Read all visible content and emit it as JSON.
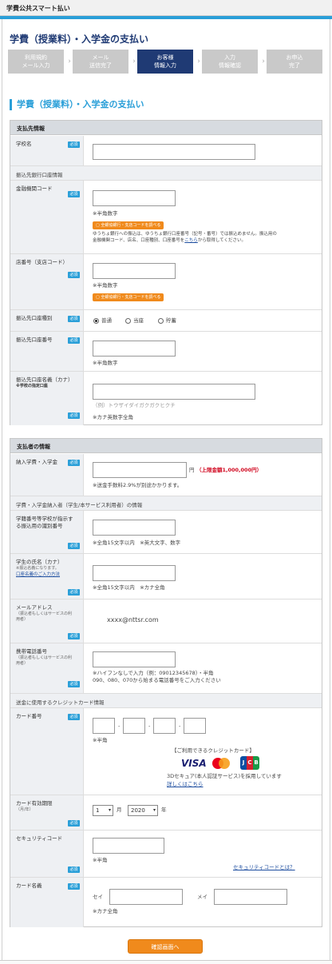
{
  "window_title": "学費公共スマート払い",
  "page_title": "学費（授業料）・入学金の支払い",
  "steps": [
    "利用規約\nメール入力",
    "メール\n送信完了",
    "お客様\n情報入力",
    "入力\n情報確認",
    "お申込\n完了"
  ],
  "section_title": "学費（授業料）・入学金の支払い",
  "required_label": "必須",
  "payee": {
    "header": "支払先情報",
    "school_label": "学校名",
    "bank_subhead": "振込先銀行口座情報",
    "bank_code_label": "金融機関コード",
    "half_digits": "※半角数字",
    "bank_code_button": "全銀協銀行・支店コードを調べる",
    "yucho_note_1": "ゆうちょ銀行への振込は、ゆうちょ銀行口座番号（記号・番号）では振込めません。振込用の",
    "yucho_note_2a": "金融機関コード、店名、口座種別、口座番号を",
    "yucho_note_link": "こちら",
    "yucho_note_2b": "から取得してください。",
    "branch_label": "店番号（支店コード）",
    "branch_button": "全銀協銀行・支店コードを調べる",
    "account_type_label": "振込先口座種別",
    "account_types": [
      "普通",
      "当座",
      "貯蓄"
    ],
    "account_number_label": "振込先口座番号",
    "account_name_label": "振込先口座名義（カナ）",
    "account_name_sub": "※学校の指定口座",
    "account_name_placeholder": "（例）トウザイダイガクガクヒクチ",
    "kana_note": "※カナ英数字全角"
  },
  "payer": {
    "header": "支払者の情報",
    "amount_label": "納入学費・入学金",
    "yen": "円",
    "limit": "（上限金額1,000,000円）",
    "fee_note": "※送金手数料2.9%が別途かかります。",
    "student_subhead": "学費・入学金納入者（学生/本サービス利用者）の情報",
    "student_id_label": "学籍番号等学校が指示する振込用の識別番号",
    "student_id_note": "※全角15文字以内　※英大文字、数字",
    "student_name_label": "学生の氏名（カナ）",
    "student_name_sub": "※振込名義になります。",
    "student_name_link": "口座名義のご入力方法",
    "student_name_note": "※全角15文字以内　※カナ全角",
    "email_label": "メールアドレス",
    "email_sub": "（振込者もしくはサービスの利用者）",
    "email_value": "xxxx@nttsr.com",
    "phone_label": "携帯電話番号",
    "phone_sub": "（振込者もしくはサービスの利用者）",
    "phone_note_1": "※ハイフンなしで入力（例：09012345678）・半角",
    "phone_note_2": "090、080、070から始まる電話番号をご入力ください",
    "card_subhead": "送金に使用するクレジットカード情報",
    "card_number_label": "カード番号",
    "card_hyphen": "-",
    "half_note": "※半角",
    "available_cards": "【ご利用できるクレジットカード】",
    "visa": "VISA",
    "jcb": [
      "J",
      "C",
      "B"
    ],
    "secure_note": "3Dセキュア(本人認証サービス)を採用しています",
    "details_link": "詳しくはこちら",
    "expiry_label": "カード有効期限",
    "expiry_sub": "（月/年）",
    "month_value": "1",
    "month_unit": "月",
    "year_value": "2020",
    "year_unit": "年",
    "cvv_label": "セキュリティコード",
    "cvv_note": "※半角",
    "cvv_link": "セキュリティコードとは？",
    "holder_label": "カード名義",
    "sei": "セイ",
    "mei": "メイ",
    "holder_note": "※カナ全角"
  },
  "confirm_button": "確認画面へ"
}
